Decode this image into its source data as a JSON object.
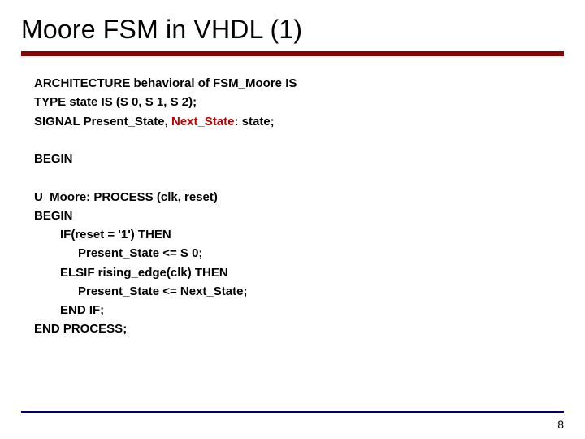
{
  "title": "Moore FSM in VHDL (1)",
  "code": {
    "l1": "ARCHITECTURE behavioral of FSM_Moore IS",
    "l2": "TYPE state IS (S 0, S 1, S 2);",
    "l3a": "SIGNAL Present_State, ",
    "l3b": "Next_State",
    "l3c": ": state;",
    "l4": "BEGIN",
    "l5": "U_Moore: PROCESS (clk, reset)",
    "l6": "BEGIN",
    "l7": "IF(reset = '1') THEN",
    "l8": "Present_State <= S 0;",
    "l9": "ELSIF rising_edge(clk) THEN",
    "l10": "Present_State <= Next_State;",
    "l11": "END IF;",
    "l12": "END PROCESS;"
  },
  "page": "8"
}
